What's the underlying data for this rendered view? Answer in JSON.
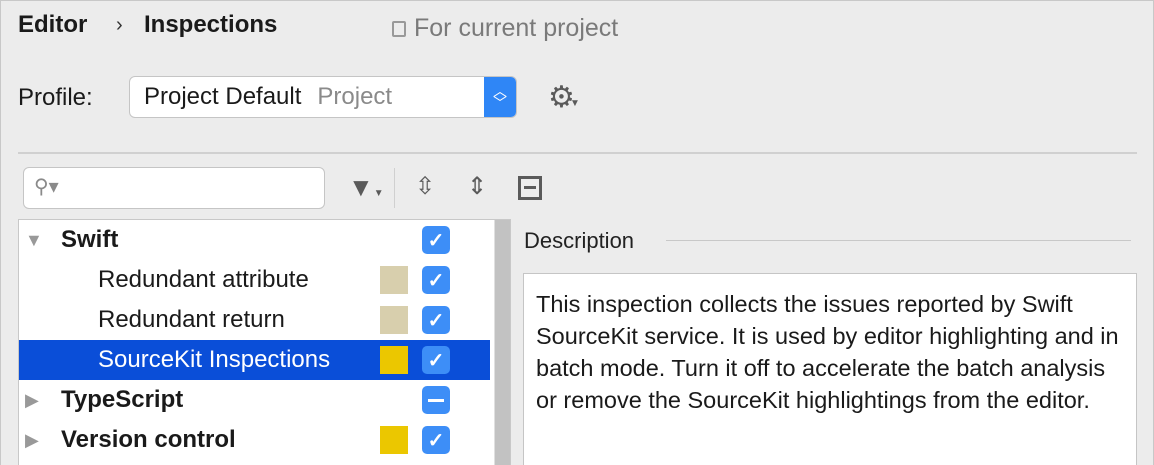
{
  "breadcrumb": {
    "parent": "Editor",
    "current": "Inspections"
  },
  "scope_label": "For current project",
  "profile": {
    "label": "Profile:",
    "value": "Project Default",
    "scope": "Project"
  },
  "search": {
    "placeholder": ""
  },
  "tree": [
    {
      "label": "Swift",
      "expanded": true,
      "bold": true,
      "checked": "checked",
      "color": null
    },
    {
      "label": "Redundant attribute",
      "child": true,
      "checked": "checked",
      "color": "#d8cfad"
    },
    {
      "label": "Redundant return",
      "child": true,
      "checked": "checked",
      "color": "#d8cfad"
    },
    {
      "label": "SourceKit Inspections",
      "child": true,
      "selected": true,
      "checked": "checked",
      "color": "#ebc700"
    },
    {
      "label": "TypeScript",
      "expanded": false,
      "bold": true,
      "checked": "partial",
      "color": null
    },
    {
      "label": "Version control",
      "expanded": false,
      "bold": true,
      "checked": "checked",
      "color": "#ebc700"
    }
  ],
  "description": {
    "title": "Description",
    "text": "This inspection collects the issues reported by Swift SourceKit service. It is used by editor highlighting and in batch mode. Turn it off to accelerate the batch analysis or remove the SourceKit highlightings from the editor."
  }
}
